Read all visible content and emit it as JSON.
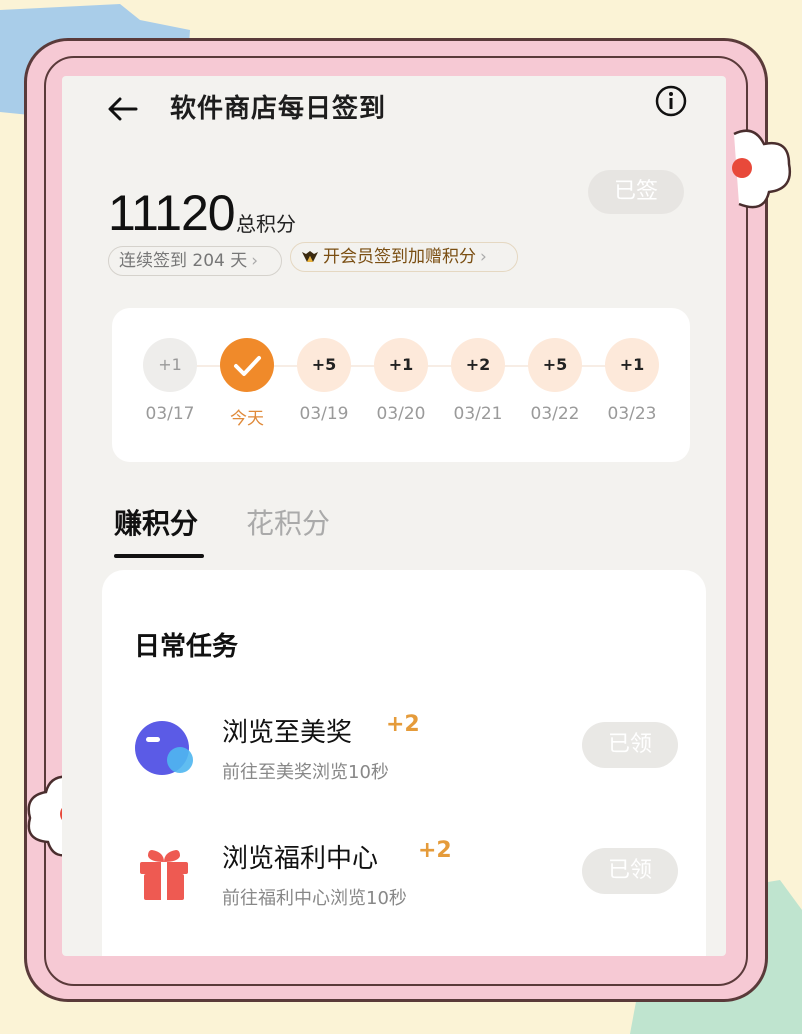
{
  "header": {
    "title": "软件商店每日签到"
  },
  "summary": {
    "points": "11120",
    "points_label": "总积分",
    "signed_button": "已签",
    "streak": "连续签到 204 天",
    "vip_promo": "开会员签到加赠积分"
  },
  "week": [
    {
      "bonus": "+1",
      "date": "03/17",
      "state": "past"
    },
    {
      "bonus": "",
      "date": "今天",
      "state": "done"
    },
    {
      "bonus": "+5",
      "date": "03/19",
      "state": "upcoming"
    },
    {
      "bonus": "+1",
      "date": "03/20",
      "state": "upcoming"
    },
    {
      "bonus": "+2",
      "date": "03/21",
      "state": "upcoming"
    },
    {
      "bonus": "+5",
      "date": "03/22",
      "state": "upcoming"
    },
    {
      "bonus": "+1",
      "date": "03/23",
      "state": "upcoming"
    }
  ],
  "tabs": {
    "earn": "赚积分",
    "spend": "花积分"
  },
  "daily": {
    "title": "日常任务",
    "tasks": [
      {
        "name": "浏览至美奖",
        "plus": "+2",
        "desc": "前往至美奖浏览10秒",
        "button": "已领",
        "icon": "planet-icon"
      },
      {
        "name": "浏览福利中心",
        "plus": "+2",
        "desc": "前往福利中心浏览10秒",
        "button": "已领",
        "icon": "gift-icon"
      }
    ]
  },
  "colors": {
    "accent": "#f08a2a",
    "plus": "#e59b3a",
    "frame_pink": "#f6c9d4",
    "background": "#fbf3d6"
  }
}
